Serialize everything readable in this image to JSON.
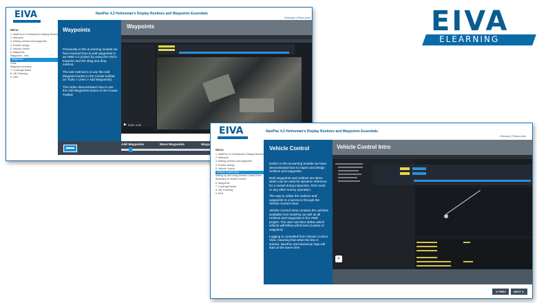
{
  "brand": {
    "logo_text": "EIVA",
    "logo_sub": "ELEARNING"
  },
  "screen1": {
    "logo": "EIVA",
    "course_title": "NaviPac 4.2 Helmsman's Display Runlines and Waypoints Essentials",
    "toplinks": "Glossary | Resources",
    "menu_label": "Menu",
    "menu": [
      "1.  NaviPac 4.2 Helmsman's Display Runlines and Waypoints Essentials",
      "2.  Welcome",
      "3.  Adding runlines and waypoints",
      "4.  Runline design",
      "5.  Vehicle Control",
      "6.  Waypoints",
      "     Waypoints - Intro",
      "     Waypoints",
      "     Grids",
      "     Waypoint summary",
      "7.  Coverage Assist",
      "8.  LBL Planning",
      "9.  Next"
    ],
    "active_index": 7,
    "lesson_title": "Waypoints",
    "lesson_p1": "Previously in this eLearning module we have learned how to add waypoints to an HMD 4.2 project by using the ASCII Importer and the drag and drop method.",
    "lesson_p2": "The last method is to use the Add Waypoint button in the Create toolbar (or Tools > Lines > Add Waypoints):",
    "lesson_p3": "This video demonstrates how to use the Add Waypoints button in the Create Toolbar",
    "main_title": "Waypoints",
    "video_time": "0:00 / 1:10",
    "chapters": [
      "Add Waypoints",
      "Move Waypoints",
      "Waypo"
    ]
  },
  "screen2": {
    "logo": "EIVA",
    "course_title": "NaviPac 4.2 Helmsman's Display Runlines and Waypoints Essentials",
    "toplinks": "Glossary | Resources",
    "menu_label": "Menu",
    "menu": [
      "1.  NaviPac 4.2 Helmsman's Display Runlines and Waypoints Essentials",
      "2.  Welcome",
      "3.  Adding runlines and waypoints",
      "4.  Runline design",
      "5.  Vehicle Control",
      "     Vehicle Control Intro",
      "     Setting up and using Vehicle Control View",
      "     Summary of Vehicle Control",
      "6.  Waypoints",
      "7.  Coverage Assist",
      "8.  LBL Planning",
      "9.  Next"
    ],
    "active_index": 5,
    "lesson_title": "Vehicle Control",
    "lesson_p1": "Earlier in this eLearning module we have demonstrated how to import and design runlines and waypoints.",
    "lesson_p2": "Both waypoints and runlines are items which can be used for dynamic reference for a vessel doing inspection, ROV work or any other survey operation.",
    "lesson_p3": "The way to utilise the runlines and waypoints in a survey is through the Vehicle Control View.",
    "lesson_p4": "Vehicle Control View contains the vehicles available from NaviPac as well as all runlines and waypoints in the HMD project. The user can then define which vehicle will follow which item (runline or waypoint).",
    "lesson_p5": "Logging is controlled from Vehicle Control View, meaning that when the line is started, NaviPac and NaviScan logs will start at the same time.",
    "main_title": "Vehicle Control Intro",
    "prev": "◄ PREV",
    "next": "NEXT ►"
  },
  "colors": {
    "brand_blue": "#0b6aa8",
    "panel_blue": "#0d5b93",
    "header_gray": "#6b7680"
  }
}
